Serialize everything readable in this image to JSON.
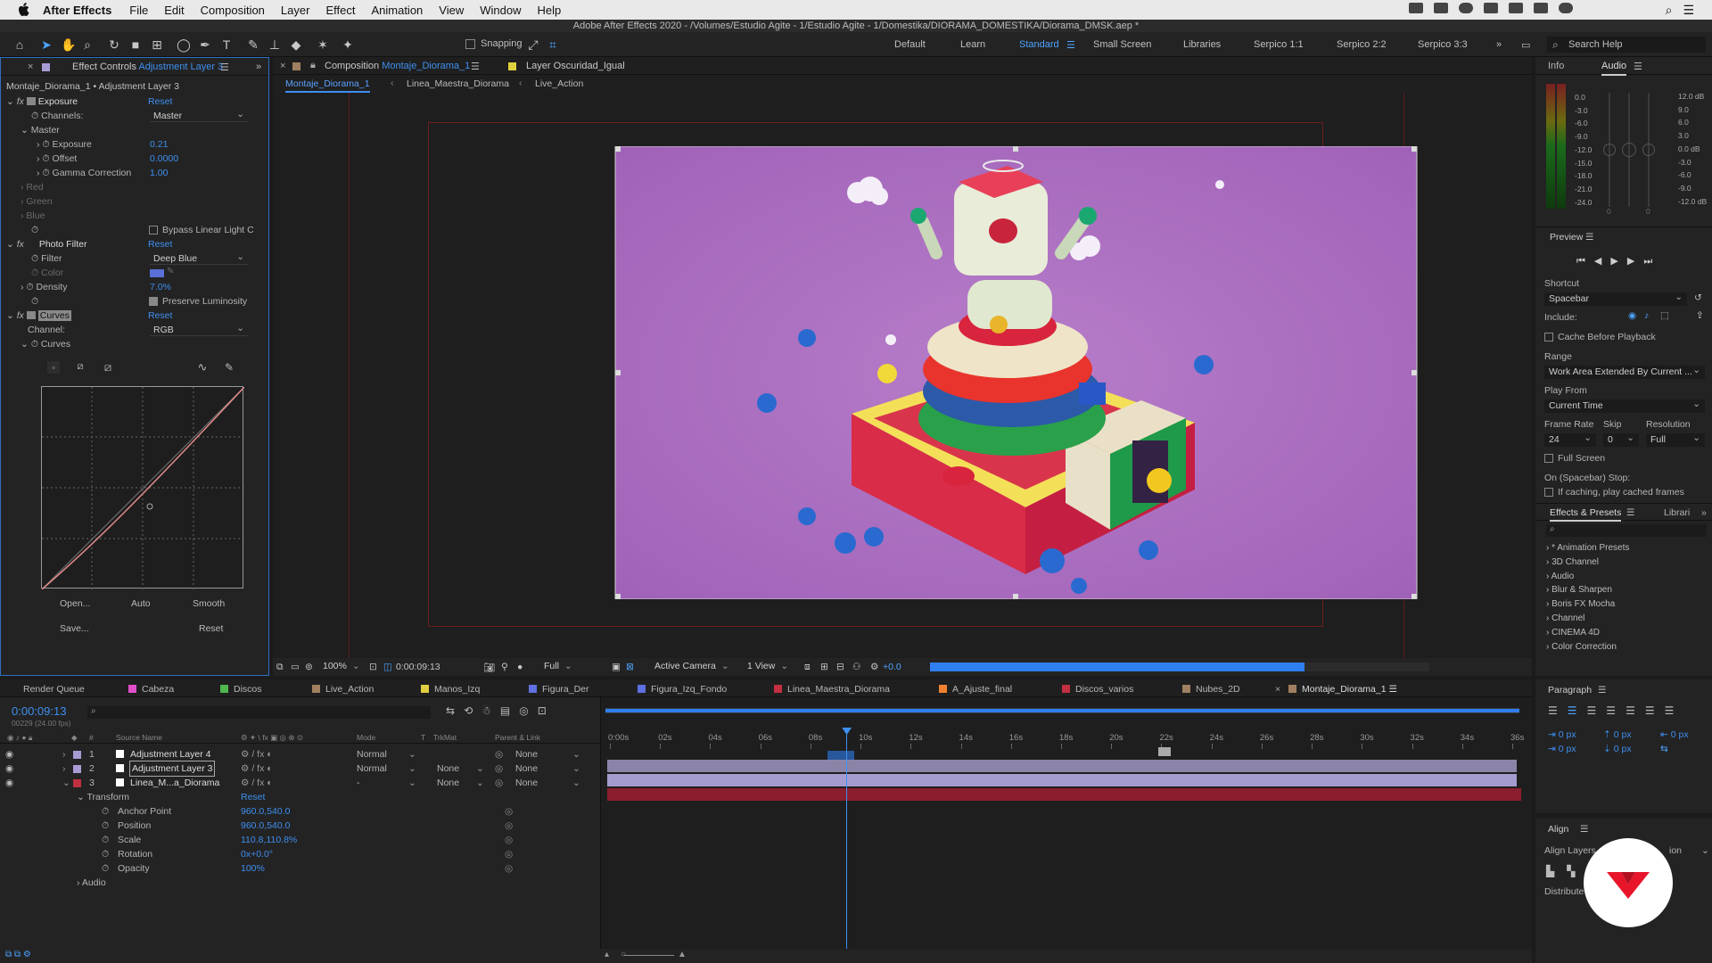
{
  "menubar": {
    "app_name": "After Effects",
    "items": [
      "File",
      "Edit",
      "Composition",
      "Layer",
      "Effect",
      "Animation",
      "View",
      "Window",
      "Help"
    ]
  },
  "window": {
    "title": "Adobe After Effects 2020 - /Volumes/Estudio Agite - 1/Estudio Agite - 1/Domestika/DIORAMA_DOMESTIKA/Diorama_DMSK.aep *"
  },
  "toolbar": {
    "snapping_label": "Snapping",
    "workspaces": [
      "Default",
      "Learn",
      "Standard",
      "Small Screen",
      "Libraries",
      "Serpico 1:1",
      "Serpico 2:2",
      "Serpico 3:3"
    ],
    "active_workspace": "Standard",
    "search_help_placeholder": "Search Help"
  },
  "effect_controls": {
    "tab_prefix": "Effect Controls",
    "tab_layer": "Adjustment Layer 3",
    "breadcrumb": "Montaje_Diorama_1 • Adjustment Layer 3",
    "reset_label": "Reset",
    "exposure": {
      "name": "Exposure",
      "channels_label": "Channels:",
      "channels_value": "Master",
      "master_label": "Master",
      "exposure_label": "Exposure",
      "exposure_value": "0.21",
      "offset_label": "Offset",
      "offset_value": "0.0000",
      "gamma_label": "Gamma Correction",
      "gamma_value": "1.00",
      "red_label": "Red",
      "green_label": "Green",
      "blue_label": "Blue",
      "bypass_label": "Bypass Linear Light C"
    },
    "photo_filter": {
      "name": "Photo Filter",
      "filter_label": "Filter",
      "filter_value": "Deep Blue",
      "color_label": "Color",
      "color_value": "#5a6fd8",
      "density_label": "Density",
      "density_value": "7.0%",
      "preserve_label": "Preserve Luminosity"
    },
    "curves": {
      "name": "Curves",
      "channel_label": "Channel:",
      "channel_value": "RGB",
      "curves_label": "Curves",
      "buttons": {
        "open": "Open...",
        "auto": "Auto",
        "smooth": "Smooth",
        "save": "Save...",
        "reset": "Reset"
      }
    }
  },
  "composition": {
    "tab_prefix": "Composition",
    "tab_name": "Montaje_Diorama_1",
    "layer_tab": "Layer Oscuridad_Igual",
    "breadcrumbs": [
      "Montaje_Diorama_1",
      "Linea_Maestra_Diorama",
      "Live_Action"
    ],
    "background_color": "#b06fc4",
    "viewer": {
      "zoom": "100%",
      "timecode": "0:00:09:13",
      "resolution": "Full",
      "camera": "Active Camera",
      "views": "1 View",
      "exposure": "+0.0",
      "render_progress": 0.75
    }
  },
  "info_panel": {
    "tab_info": "Info",
    "tab_audio": "Audio",
    "audio_db_left": [
      "0.0",
      "-3.0",
      "-6.0",
      "-9.0",
      "-12.0",
      "-15.0",
      "-18.0",
      "-21.0",
      "-24.0"
    ],
    "audio_db_right": [
      "12.0 dB",
      "9.0",
      "6.0",
      "3.0",
      "0.0 dB",
      "-3.0",
      "-6.0",
      "-9.0",
      "-12.0 dB"
    ],
    "zero_labels": [
      "0",
      "0"
    ]
  },
  "preview_panel": {
    "title": "Preview",
    "shortcut_label": "Shortcut",
    "shortcut_value": "Spacebar",
    "include_label": "Include:",
    "cache_label": "Cache Before Playback",
    "range_label": "Range",
    "range_value": "Work Area Extended By Current ...",
    "play_from_label": "Play From",
    "play_from_value": "Current Time",
    "frame_rate_label": "Frame Rate",
    "skip_label": "Skip",
    "resolution_label": "Resolution",
    "frame_rate_value": "24",
    "skip_value": "0",
    "resolution_value": "Full",
    "fullscreen_label": "Full Screen",
    "stop_label": "On (Spacebar) Stop:",
    "caching_label": "If caching, play cached frames"
  },
  "effects_presets": {
    "tab": "Effects & Presets",
    "tab_libraries": "Librari",
    "items": [
      "* Animation Presets",
      "3D Channel",
      "Audio",
      "Blur & Sharpen",
      "Boris FX Mocha",
      "Channel",
      "CINEMA 4D",
      "Color Correction"
    ]
  },
  "timeline": {
    "render_queue": "Render Queue",
    "tabs": [
      {
        "label": "Cabeza",
        "color": "#e04fc8"
      },
      {
        "label": "Discos",
        "color": "#4fb84f"
      },
      {
        "label": "Live_Action",
        "color": "#a08060"
      },
      {
        "label": "Manos_Izq",
        "color": "#e0d040"
      },
      {
        "label": "Figura_Der",
        "color": "#6070e0"
      },
      {
        "label": "Figura_Izq_Fondo",
        "color": "#6070e0"
      },
      {
        "label": "Linea_Maestra_Diorama",
        "color": "#c03040"
      },
      {
        "label": "A_Ajuste_final",
        "color": "#f08030"
      },
      {
        "label": "Discos_varios",
        "color": "#c03040"
      },
      {
        "label": "Nubes_2D",
        "color": "#a08060"
      },
      {
        "label": "Montaje_Diorama_1",
        "color": "#a08060"
      }
    ],
    "current_time": "0:00:09:13",
    "frame_info": "00229 (24.00 fps)",
    "columns": {
      "source_name": "Source Name",
      "mode": "Mode",
      "t": "T",
      "trkmat": "TrkMat",
      "parent": "Parent & Link"
    },
    "ruler": [
      "0:00s",
      "02s",
      "04s",
      "06s",
      "08s",
      "10s",
      "12s",
      "14s",
      "16s",
      "18s",
      "20s",
      "22s",
      "24s",
      "26s",
      "28s",
      "30s",
      "32s",
      "34s",
      "36s"
    ],
    "playhead_fraction": 0.264,
    "layers": [
      {
        "num": "1",
        "name": "Adjustment Layer 4",
        "mode": "Normal",
        "trkmat": "",
        "parent": "None",
        "label_color": "#a99bd6"
      },
      {
        "num": "2",
        "name": "Adjustment Layer 3",
        "mode": "Normal",
        "trkmat": "None",
        "parent": "None",
        "label_color": "#a99bd6"
      },
      {
        "num": "3",
        "name": "Linea_M...a_Diorama",
        "mode": "-",
        "trkmat": "None",
        "parent": "None",
        "label_color": "#c03040"
      }
    ],
    "transform": {
      "label": "Transform",
      "reset": "Reset",
      "props": [
        {
          "name": "Anchor Point",
          "value": "960.0,540.0"
        },
        {
          "name": "Position",
          "value": "960.0,540.0"
        },
        {
          "name": "Scale",
          "value": "110.8,110.8%"
        },
        {
          "name": "Rotation",
          "value": "0x+0.0°"
        },
        {
          "name": "Opacity",
          "value": "100%"
        }
      ]
    },
    "audio_label": "Audio"
  },
  "paragraph_panel": {
    "title": "Paragraph",
    "values": [
      "0 px",
      "0 px",
      "0 px",
      "0 px",
      "0 px"
    ]
  },
  "align_panel": {
    "title": "Align",
    "align_layers_label": "Align Layers",
    "to_selection": "ion",
    "distribute_label": "Distribute"
  }
}
